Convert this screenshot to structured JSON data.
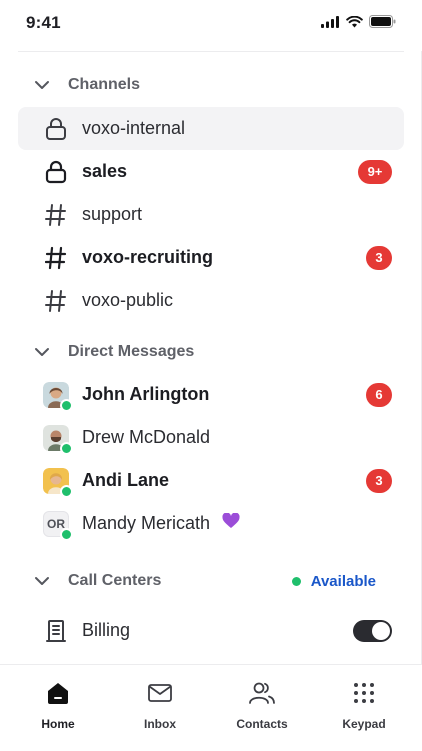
{
  "status_bar": {
    "time": "9:41"
  },
  "sections": {
    "channels": {
      "title": "Channels"
    },
    "direct_messages": {
      "title": "Direct Messages"
    },
    "call_centers": {
      "title": "Call Centers",
      "availability": "Available"
    }
  },
  "channels": [
    {
      "name": "voxo-internal",
      "icon": "lock-icon",
      "bold": false,
      "badge": ""
    },
    {
      "name": "sales",
      "icon": "lock-icon",
      "bold": true,
      "badge": "9+"
    },
    {
      "name": "support",
      "icon": "hash-icon",
      "bold": false,
      "badge": ""
    },
    {
      "name": "voxo-recruiting",
      "icon": "hash-icon",
      "bold": true,
      "badge": "3"
    },
    {
      "name": "voxo-public",
      "icon": "hash-icon",
      "bold": false,
      "badge": ""
    }
  ],
  "direct_messages": [
    {
      "name": "John Arlington",
      "bold": true,
      "badge": "6"
    },
    {
      "name": "Drew McDonald",
      "bold": false,
      "badge": ""
    },
    {
      "name": "Andi Lane",
      "bold": true,
      "badge": "3"
    },
    {
      "name": "Mandy Mericath",
      "bold": false,
      "badge": "",
      "initials": "OR",
      "emoji": "💜"
    }
  ],
  "call_centers": [
    {
      "name": "Billing",
      "icon": "building-icon",
      "toggle_on": true
    }
  ],
  "tabs": [
    {
      "label": "Home",
      "icon": "home-icon",
      "active": true
    },
    {
      "label": "Inbox",
      "icon": "mail-icon",
      "active": false
    },
    {
      "label": "Contacts",
      "icon": "users-icon",
      "active": false
    },
    {
      "label": "Keypad",
      "icon": "keypad-icon",
      "active": false
    }
  ],
  "colors": {
    "badge": "#e53935",
    "presence": "#1fbf6c",
    "available_text": "#1a57c9",
    "toggle": "#2a2b30"
  }
}
